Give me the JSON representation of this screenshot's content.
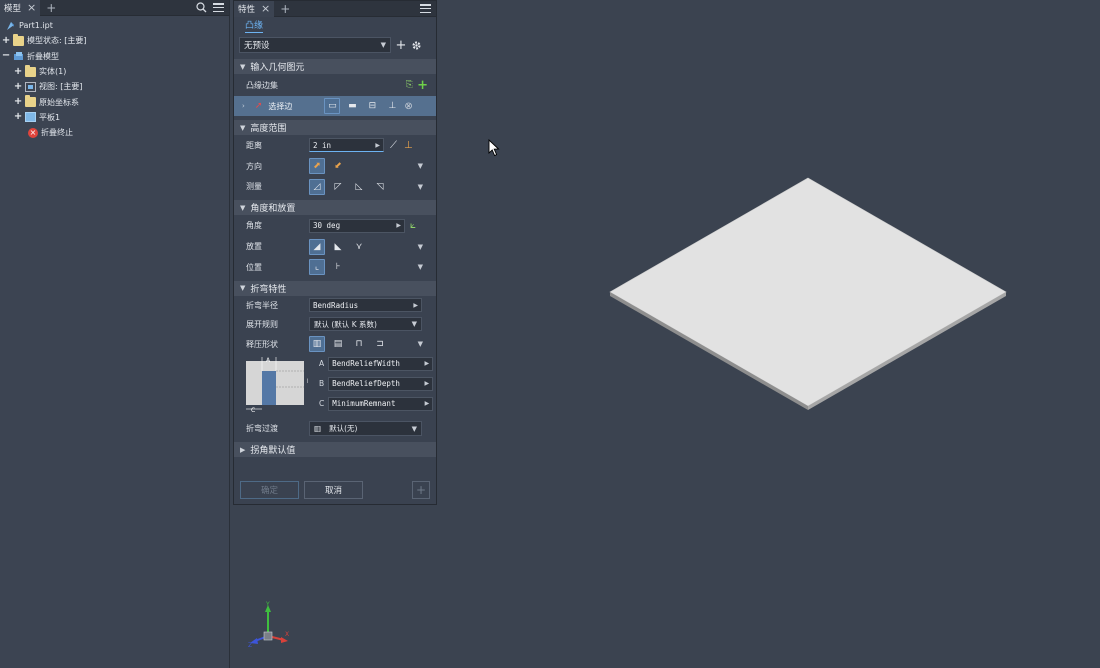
{
  "browser": {
    "tab_label": "模型",
    "tree": [
      {
        "label": "Part1.ipt",
        "level": 0,
        "expander": "",
        "icon": "part-file-icon"
      },
      {
        "label": "模型状态: [主要]",
        "level": 0,
        "expander": "+",
        "icon": "folder-icon"
      },
      {
        "label": "折叠模型",
        "level": 0,
        "expander": "−",
        "icon": "sheetmetal-model-icon"
      },
      {
        "label": "实体(1)",
        "level": 1,
        "expander": "+",
        "icon": "solid-body-folder-icon"
      },
      {
        "label": "视图: [主要]",
        "level": 1,
        "expander": "+",
        "icon": "view-icon"
      },
      {
        "label": "原始坐标系",
        "level": 1,
        "expander": "+",
        "icon": "folder-icon"
      },
      {
        "label": "平板1",
        "level": 1,
        "expander": "+",
        "icon": "face-plate-icon"
      },
      {
        "label": "折叠终止",
        "level": 1,
        "expander": "",
        "icon": "end-of-fold-error-icon"
      }
    ]
  },
  "props": {
    "tab_label": "特性",
    "feature_name": "凸缘",
    "preset": "无预设",
    "sections": {
      "input_geometry": "输入几何图元",
      "height_extent": "高度范围",
      "angle_placement": "角度和放置",
      "bend_props": "折弯特性",
      "corner_defaults": "拐角默认值"
    },
    "flange_edges_label": "凸缘边集",
    "select_edge_label": "选择边",
    "distance_label": "距离",
    "distance_value": "2 in",
    "direction_label": "方向",
    "measure_label": "测量",
    "angle_label": "角度",
    "angle_value": "30 deg",
    "place_label": "放置",
    "position_label": "位置",
    "bend_radius_label": "折弯半径",
    "bend_radius_value": "BendRadius",
    "unfold_rule_label": "展开规则",
    "unfold_rule_value": "默认 (默认 K 系数)",
    "relief_shape_label": "释压形状",
    "relief": {
      "a_label": "A",
      "a_value": "BendReliefWidth",
      "b_label": "B",
      "b_value": "BendReliefDepth",
      "c_label": "C",
      "c_value": "MinimumRemnant"
    },
    "bend_transition_label": "折弯过渡",
    "bend_transition_value": "默认(无)",
    "ok_label": "确定",
    "cancel_label": "取消"
  },
  "colors": {
    "viewport_bg": "#3b4350",
    "panel_bg": "#3a4250",
    "accent_blue": "#6db3f2",
    "plate_face": "#e2e2e2"
  }
}
